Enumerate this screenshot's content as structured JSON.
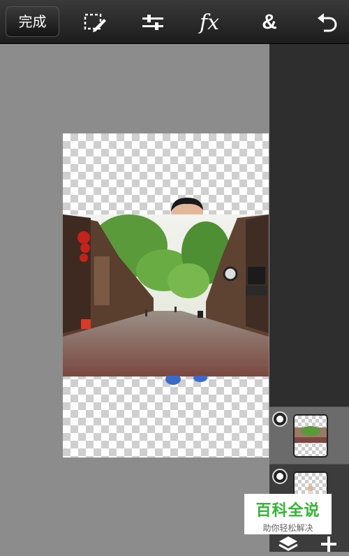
{
  "toolbar": {
    "done_label": "完成",
    "tools": [
      {
        "icon": "selection-edit-icon"
      },
      {
        "icon": "sliders-adjust-icon"
      },
      {
        "icon": "fx-effects-icon",
        "label": "fx"
      },
      {
        "icon": "blend-ampersand-icon",
        "label": "&"
      },
      {
        "icon": "undo-icon"
      }
    ]
  },
  "canvas": {
    "photo": "street-scene-photo",
    "layer_person": "person-cutout-layer"
  },
  "layers": [
    {
      "name": "street-photo-layer",
      "selected": true
    },
    {
      "name": "person-layer",
      "selected": false
    }
  ],
  "bottom_bar": {
    "icons": [
      "layers-icon",
      "add-layer-icon"
    ]
  },
  "watermark": {
    "title": "百科全说",
    "subtitle": "助你轻松解决"
  },
  "colors": {
    "toolbar_bg": "#1c1c1c",
    "canvas_bg": "#8c8c8c",
    "panel_bg": "#2e2e2e",
    "watermark_green": "#2eb82e"
  }
}
